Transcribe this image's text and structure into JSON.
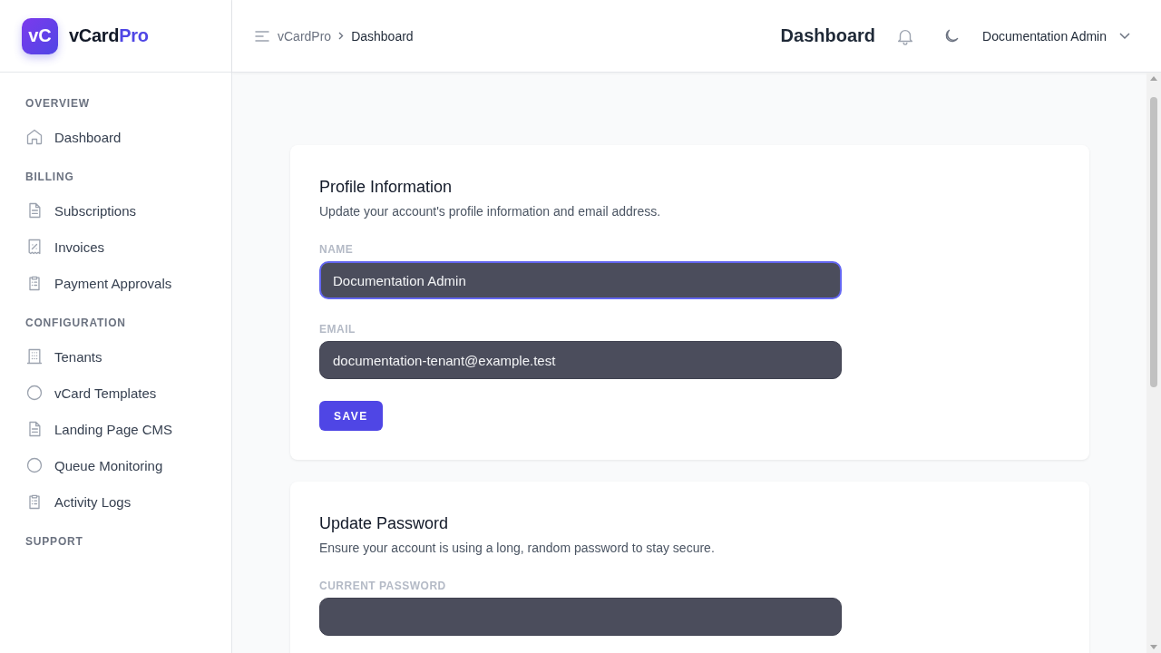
{
  "brand": {
    "logo": "vC",
    "name": "vCard",
    "name_accent": "Pro"
  },
  "breadcrumb": [
    "vCardPro",
    "Dashboard"
  ],
  "header": {
    "title": "Dashboard",
    "user": "Documentation Admin"
  },
  "sidebar": {
    "sections": [
      {
        "label": "OVERVIEW",
        "items": [
          {
            "label": "Dashboard",
            "kind": "home"
          }
        ]
      },
      {
        "label": "BILLING",
        "items": [
          {
            "label": "Subscriptions",
            "kind": "document"
          },
          {
            "label": "Invoices",
            "kind": "receipt"
          },
          {
            "label": "Payment Approvals",
            "kind": "clipboard"
          }
        ]
      },
      {
        "label": "CONFIGURATION",
        "items": [
          {
            "label": "Tenants",
            "kind": "building"
          },
          {
            "label": "vCard Templates",
            "kind": "circle"
          },
          {
            "label": "Landing Page CMS",
            "kind": "document"
          },
          {
            "label": "Queue Monitoring",
            "kind": "circle"
          },
          {
            "label": "Activity Logs",
            "kind": "clipboard"
          }
        ]
      },
      {
        "label": "SUPPORT"
      }
    ]
  },
  "cards": [
    {
      "title": "Profile Information",
      "description": "Update your account's profile information and email address.",
      "fields": [
        {
          "label": "NAME",
          "value": "Documentation Admin",
          "focused": true
        },
        {
          "label": "EMAIL",
          "value": "documentation-tenant@example.test",
          "focused": false
        }
      ],
      "button": "SAVE"
    },
    {
      "title": "Update Password",
      "description": "Ensure your account is using a long, random password to stay secure.",
      "fields": [
        {
          "label": "CURRENT PASSWORD",
          "focused": false
        }
      ]
    }
  ]
}
